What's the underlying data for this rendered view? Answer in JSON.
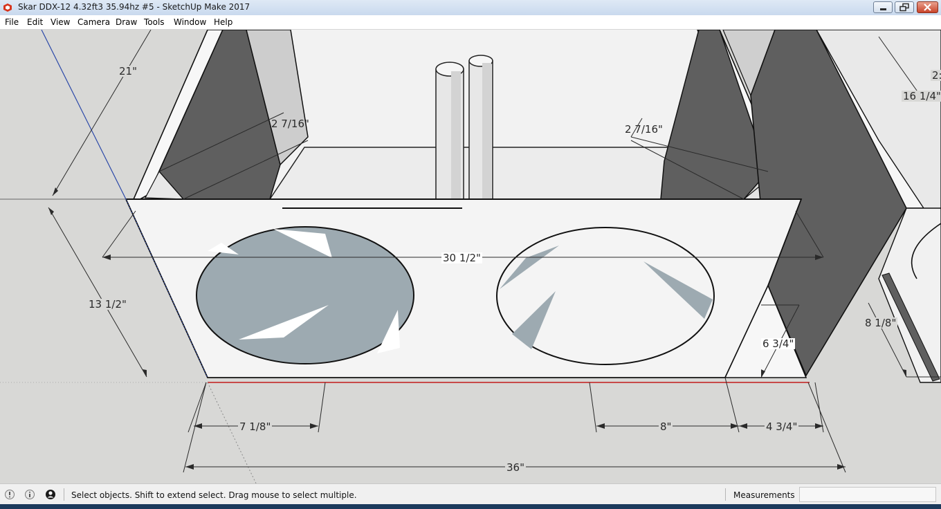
{
  "window": {
    "title": "Skar DDX-12 4.32ft3 35.94hz #5 - SketchUp Make 2017",
    "icon": "sketchup-icon",
    "controls": [
      "minimize-icon",
      "maximize-icon",
      "close-icon"
    ]
  },
  "menu": {
    "items": [
      {
        "label": "File"
      },
      {
        "label": "Edit"
      },
      {
        "label": "View"
      },
      {
        "label": "Camera"
      },
      {
        "label": "Draw"
      },
      {
        "label": "Tools"
      },
      {
        "label": "Window"
      },
      {
        "label": "Help"
      }
    ]
  },
  "model": {
    "dimensions": {
      "d21": "21\"",
      "d16_1_4": "16 1/4\"",
      "d2_7_16_left": "2 7/16\"",
      "d2_7_16_right": "2 7/16\"",
      "d30_1_2": "30 1/2\"",
      "d13_1_2": "13 1/2\"",
      "d8_1_8": "8 1/8\"",
      "d6_3_4": "6 3/4\"",
      "d7_1_8": "7 1/8\"",
      "d8": "8\"",
      "d4_3_4": "4 3/4\"",
      "d36": "36\"",
      "d2_partial": "2:"
    },
    "colors": {
      "background": "#d8d8d6",
      "face_white": "#f4f4f4",
      "dark_panel": "#626262",
      "speaker_fill": "#9daab1",
      "axis_blue": "#2b48a8",
      "axis_red": "#c21a1a"
    }
  },
  "status": {
    "icons": [
      "geo-location-icon",
      "credits-icon",
      "user-account-icon"
    ],
    "message": "Select objects. Shift to extend select. Drag mouse to select multiple.",
    "measurements_label": "Measurements",
    "measurements_value": ""
  }
}
